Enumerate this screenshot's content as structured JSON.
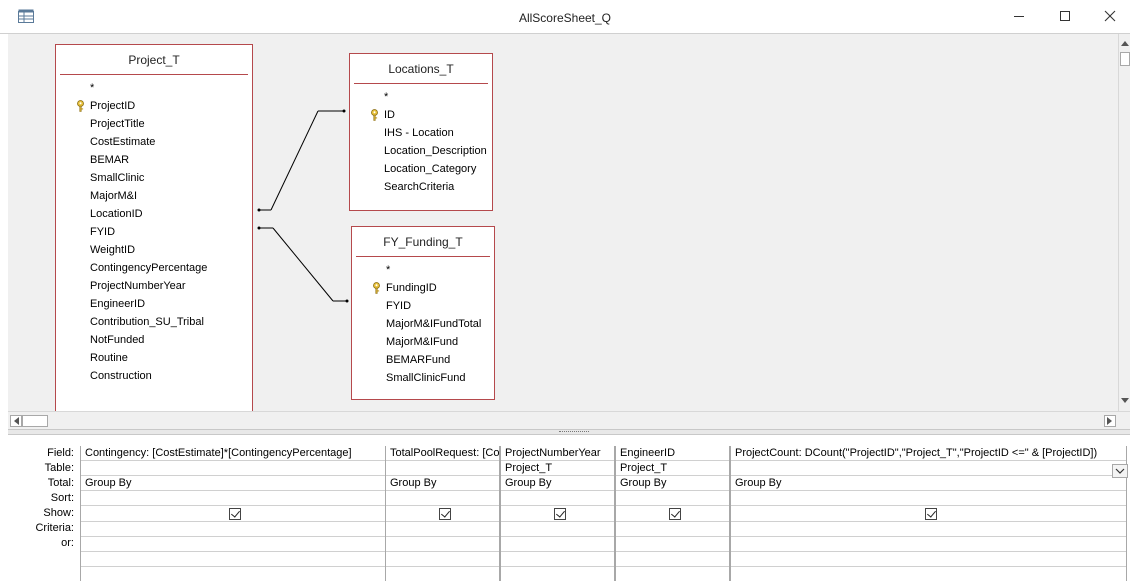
{
  "window": {
    "title": "AllScoreSheet_Q",
    "app_icon": "query-icon",
    "controls": [
      "minimize-icon",
      "maximize-icon",
      "close-icon"
    ]
  },
  "tables": [
    {
      "name": "Project_T",
      "fields": [
        {
          "label": "*",
          "key": false
        },
        {
          "label": "ProjectID",
          "key": true
        },
        {
          "label": "ProjectTitle",
          "key": false
        },
        {
          "label": "CostEstimate",
          "key": false
        },
        {
          "label": "BEMAR",
          "key": false
        },
        {
          "label": "SmallClinic",
          "key": false
        },
        {
          "label": "MajorM&I",
          "key": false
        },
        {
          "label": "LocationID",
          "key": false
        },
        {
          "label": "FYID",
          "key": false
        },
        {
          "label": "WeightID",
          "key": false
        },
        {
          "label": "ContingencyPercentage",
          "key": false
        },
        {
          "label": "ProjectNumberYear",
          "key": false
        },
        {
          "label": "EngineerID",
          "key": false
        },
        {
          "label": "Contribution_SU_Tribal",
          "key": false
        },
        {
          "label": "NotFunded",
          "key": false
        },
        {
          "label": "Routine",
          "key": false
        },
        {
          "label": "Construction",
          "key": false
        }
      ]
    },
    {
      "name": "Locations_T",
      "fields": [
        {
          "label": "*",
          "key": false
        },
        {
          "label": "ID",
          "key": true
        },
        {
          "label": "IHS - Location",
          "key": false
        },
        {
          "label": "Location_Description",
          "key": false
        },
        {
          "label": "Location_Category",
          "key": false
        },
        {
          "label": "SearchCriteria",
          "key": false
        }
      ]
    },
    {
      "name": "FY_Funding_T",
      "fields": [
        {
          "label": "*",
          "key": false
        },
        {
          "label": "FundingID",
          "key": true
        },
        {
          "label": "FYID",
          "key": false
        },
        {
          "label": "MajorM&IFundTotal",
          "key": false
        },
        {
          "label": "MajorM&IFund",
          "key": false
        },
        {
          "label": "BEMARFund",
          "key": false
        },
        {
          "label": "SmallClinicFund",
          "key": false
        }
      ]
    }
  ],
  "grid": {
    "row_labels": [
      "Field:",
      "Table:",
      "Total:",
      "Sort:",
      "Show:",
      "Criteria:",
      "or:"
    ],
    "columns": [
      {
        "field": "Contingency: [CostEstimate]*[ContingencyPercentage]",
        "table": "",
        "total": "Group By",
        "show": true
      },
      {
        "field": "TotalPoolRequest: [CostEstimate]",
        "table": "",
        "total": "Group By",
        "show": true
      },
      {
        "field": "ProjectNumberYear",
        "table": "Project_T",
        "total": "Group By",
        "show": true
      },
      {
        "field": "EngineerID",
        "table": "Project_T",
        "total": "Group By",
        "show": true
      },
      {
        "field": "ProjectCount: DCount(\"ProjectID\",\"Project_T\",\"ProjectID <=\" & [ProjectID])",
        "table": "",
        "total": "Group By",
        "show": true
      }
    ]
  }
}
